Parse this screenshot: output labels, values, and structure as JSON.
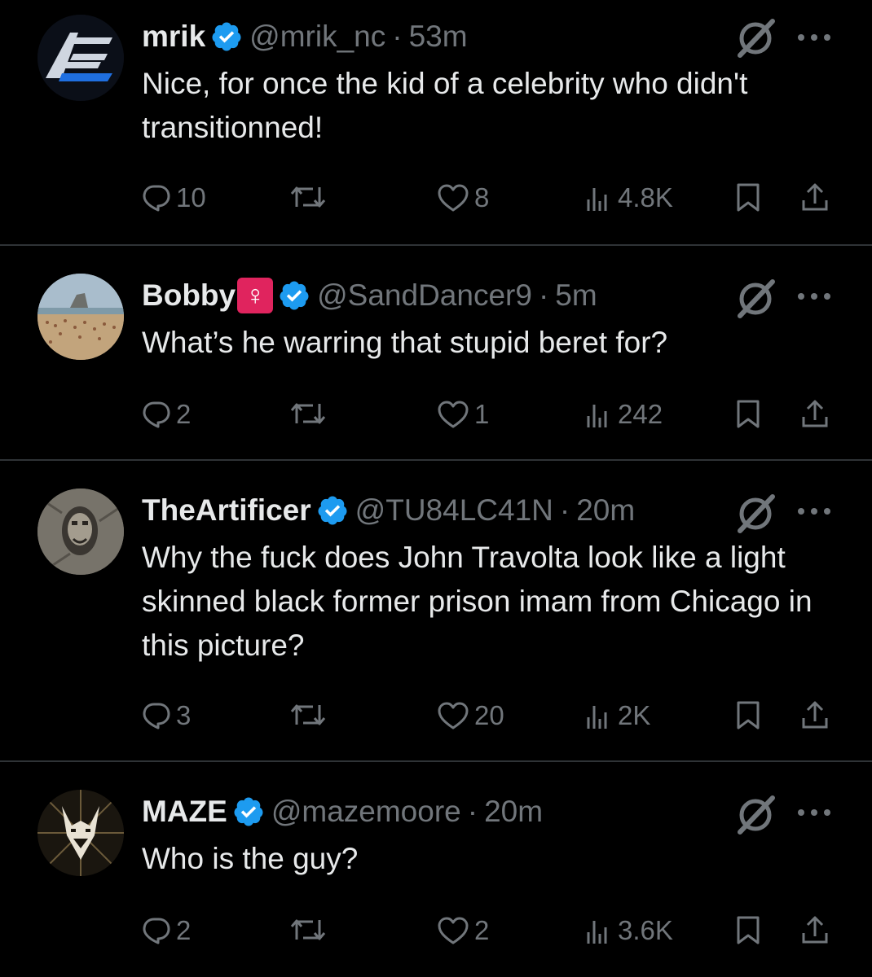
{
  "tweets": [
    {
      "name": "mrik",
      "handle": "@mrik_nc",
      "separator": "·",
      "time": "53m",
      "text": "Nice, for once the kid of a celebrity who didn't transitionned!",
      "replies": "10",
      "reposts": "",
      "likes": "8",
      "views": "4.8K"
    },
    {
      "name": "Bobby",
      "name_emoji": "♀",
      "handle": "@SandDancer9",
      "separator": "·",
      "time": "5m",
      "text": "What’s he warring that stupid beret for?",
      "replies": "2",
      "reposts": "",
      "likes": "1",
      "views": "242"
    },
    {
      "name": "TheArtificer",
      "handle": "@TU84LC41N",
      "separator": "·",
      "time": "20m",
      "text": "Why the fuck does John Travolta look like a light skinned black former prison imam from Chicago in this picture?",
      "replies": "3",
      "reposts": "",
      "likes": "20",
      "views": "2K"
    },
    {
      "name": "MAZE",
      "handle": "@mazemoore",
      "separator": "·",
      "time": "20m",
      "text": "Who is the guy?",
      "replies": "2",
      "reposts": "",
      "likes": "2",
      "views": "3.6K"
    }
  ],
  "colors": {
    "background": "#000000",
    "text": "#e7e9ea",
    "muted": "#71767b",
    "verified": "#1d9bf0",
    "divider": "#2f3336"
  },
  "icons": [
    "verified-badge-icon",
    "grok-icon",
    "more-icon",
    "reply-icon",
    "repost-icon",
    "like-icon",
    "views-icon",
    "bookmark-icon",
    "share-icon"
  ]
}
